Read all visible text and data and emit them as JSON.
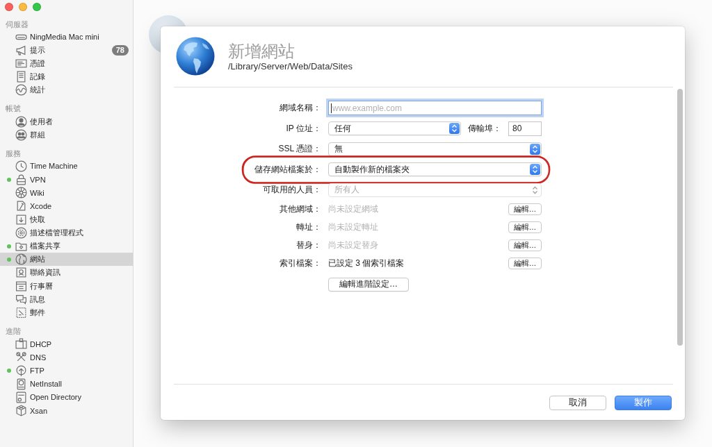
{
  "sidebar": {
    "sections": [
      {
        "title": "伺服器",
        "items": [
          {
            "label": "NingMedia Mac mini",
            "selected": false,
            "running": false
          },
          {
            "label": "提示",
            "badge": "78",
            "selected": false,
            "running": false
          },
          {
            "label": "憑證",
            "selected": false,
            "running": false
          },
          {
            "label": "記錄",
            "selected": false,
            "running": false
          },
          {
            "label": "統計",
            "selected": false,
            "running": false
          }
        ]
      },
      {
        "title": "帳號",
        "items": [
          {
            "label": "使用者",
            "selected": false,
            "running": false
          },
          {
            "label": "群組",
            "selected": false,
            "running": false
          }
        ]
      },
      {
        "title": "服務",
        "items": [
          {
            "label": "Time Machine",
            "selected": false,
            "running": false
          },
          {
            "label": "VPN",
            "selected": false,
            "running": true
          },
          {
            "label": "Wiki",
            "selected": false,
            "running": false
          },
          {
            "label": "Xcode",
            "selected": false,
            "running": false
          },
          {
            "label": "快取",
            "selected": false,
            "running": false
          },
          {
            "label": "描述檔管理程式",
            "selected": false,
            "running": false
          },
          {
            "label": "檔案共享",
            "selected": false,
            "running": true
          },
          {
            "label": "網站",
            "selected": true,
            "running": true
          },
          {
            "label": "聯絡資訊",
            "selected": false,
            "running": false
          },
          {
            "label": "行事曆",
            "selected": false,
            "running": false
          },
          {
            "label": "訊息",
            "selected": false,
            "running": false
          },
          {
            "label": "郵件",
            "selected": false,
            "running": false
          }
        ]
      },
      {
        "title": "進階",
        "items": [
          {
            "label": "DHCP",
            "selected": false,
            "running": false
          },
          {
            "label": "DNS",
            "selected": false,
            "running": false
          },
          {
            "label": "FTP",
            "selected": false,
            "running": true
          },
          {
            "label": "NetInstall",
            "selected": false,
            "running": false
          },
          {
            "label": "Open Directory",
            "selected": false,
            "running": false
          },
          {
            "label": "Xsan",
            "selected": false,
            "running": false
          }
        ]
      }
    ]
  },
  "dialog": {
    "title": "新增網站",
    "subtitle": "/Library/Server/Web/Data/Sites",
    "form": [
      {
        "kind": "text",
        "label": "網域名稱：",
        "placeholder": "www.example.com",
        "focused": true,
        "highlighted": false
      },
      {
        "kind": "popup",
        "label": "IP 位址：",
        "value": "任何",
        "disabled": false,
        "highlighted": false,
        "port": {
          "label": "傳輸埠：",
          "value": "80",
          "focused": false
        }
      },
      {
        "kind": "popup",
        "label": "SSL 憑證：",
        "value": "無",
        "disabled": false,
        "highlighted": false
      },
      {
        "kind": "popup",
        "label": "儲存網站檔案於：",
        "value": "自動製作新的檔案夾",
        "disabled": false,
        "highlighted": true
      },
      {
        "kind": "popup",
        "label": "可取用的人員：",
        "value": "所有人",
        "disabled": true,
        "highlighted": false
      },
      {
        "kind": "summary",
        "label": "其他網域：",
        "value": "尚未設定網域",
        "dimmed": true,
        "button": "編輯…",
        "highlighted": false
      },
      {
        "kind": "summary",
        "label": "轉址：",
        "value": "尚未設定轉址",
        "dimmed": true,
        "button": "編輯…",
        "highlighted": false
      },
      {
        "kind": "summary",
        "label": "替身：",
        "value": "尚未設定替身",
        "dimmed": true,
        "button": "編輯…",
        "highlighted": false
      },
      {
        "kind": "summary",
        "label": "索引檔案：",
        "value": "已設定 3 個索引檔案",
        "dimmed": false,
        "button": "編輯…",
        "highlighted": false
      },
      {
        "kind": "button",
        "label": "編輯進階設定…",
        "highlighted": false
      }
    ],
    "buttons": [
      {
        "kind": "cancel",
        "label": "取消"
      },
      {
        "kind": "default",
        "label": "製作"
      }
    ]
  }
}
